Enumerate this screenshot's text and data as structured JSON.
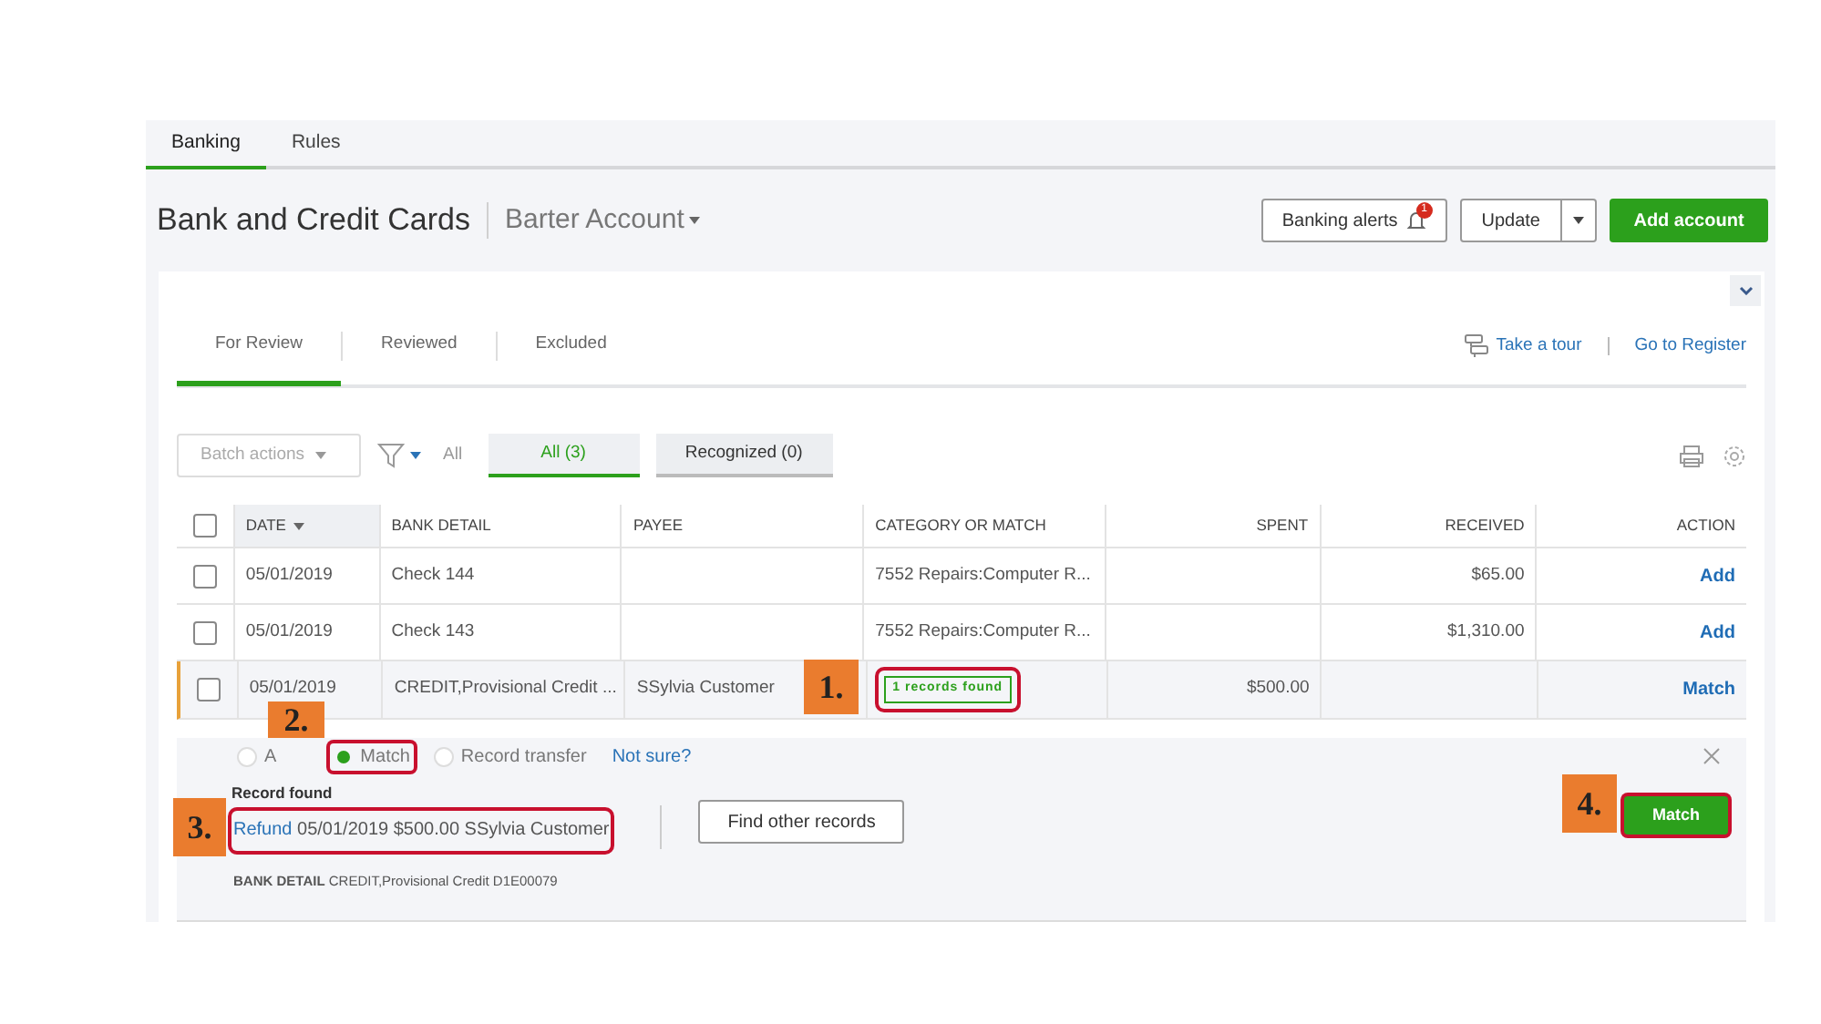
{
  "nav_tabs": [
    {
      "label": "Banking",
      "selected": true
    },
    {
      "label": "Rules",
      "selected": false
    }
  ],
  "header": {
    "title": "Bank and Credit Cards",
    "account": "Barter Account",
    "alerts_button": "Banking alerts",
    "alerts_count": "1",
    "update_button": "Update",
    "add_button": "Add account"
  },
  "review_tabs": [
    {
      "label": "For Review",
      "selected": true
    },
    {
      "label": "Reviewed",
      "selected": false
    },
    {
      "label": "Excluded",
      "selected": false
    }
  ],
  "links": [
    "Take a tour",
    "Go to Register"
  ],
  "filter": {
    "batch_actions": "Batch actions",
    "filter_value": "All",
    "chips": [
      {
        "label": "All (3)",
        "selected": true
      },
      {
        "label": "Recognized (0)",
        "selected": false
      }
    ]
  },
  "table": {
    "select_all_checked": false,
    "columns": [
      "DATE",
      "BANK DETAIL",
      "PAYEE",
      "CATEGORY OR MATCH",
      "SPENT",
      "RECEIVED",
      "ACTION"
    ],
    "rows": [
      {
        "checked": false,
        "expanded": false,
        "date": "05/01/2019",
        "bank_detail": "Check 144",
        "category": {
          "kind": "text",
          "text": "7552 Repairs:Computer R..."
        },
        "received": "$65.00",
        "action": "Add"
      },
      {
        "checked": false,
        "expanded": false,
        "date": "05/01/2019",
        "bank_detail": "Check 143",
        "category": {
          "kind": "text",
          "text": "7552 Repairs:Computer R..."
        },
        "received": "$1,310.00",
        "action": "Add"
      },
      {
        "checked": false,
        "expanded": true,
        "date": "05/01/2019",
        "bank_detail": "CREDIT,Provisional Credit ...",
        "payee": "SSylvia Customer",
        "category": {
          "kind": "badge",
          "text": "1 records found",
          "highlighted": true
        },
        "spent": "$500.00",
        "action": "Match"
      }
    ]
  },
  "match_panel": {
    "options": [
      {
        "label": "A",
        "selected": false,
        "highlighted": false
      },
      {
        "label": "Match",
        "selected": true,
        "highlighted": true
      },
      {
        "label": "Record transfer",
        "selected": false,
        "highlighted": false
      }
    ],
    "not_sure": "Not sure?",
    "record_heading": "Record found",
    "record_link": "Refund",
    "record_details": "05/01/2019 $500.00 SSylvia Customer",
    "record_highlighted": true,
    "find_button": "Find other records",
    "match_button": "Match",
    "match_highlighted": true,
    "bank_detail_label": "BANK DETAIL",
    "bank_detail_value": "CREDIT,Provisional Credit D1E00079"
  },
  "callouts": [
    "1.",
    "2.",
    "3.",
    "4."
  ]
}
